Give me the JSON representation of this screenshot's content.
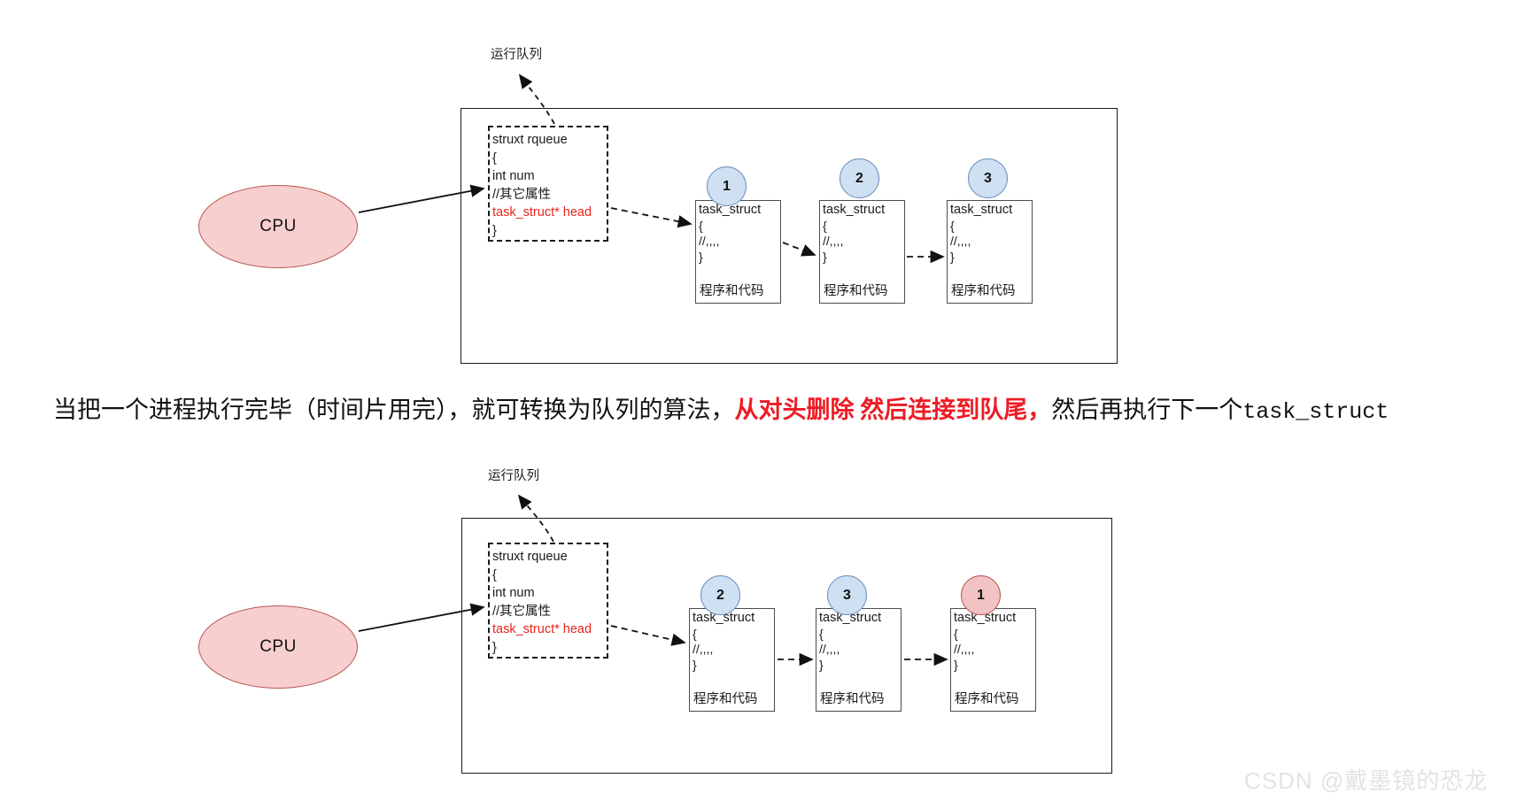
{
  "diagram": {
    "type": "linked-list-run-queue",
    "caption": {
      "part1": "当把一个进程执行完毕（时间片用完），就可转换为队列的算法，",
      "part2_red": "从对头删除 然后连接到队尾，",
      "part3": "然后再执行下一个",
      "part4_mono": "task_struct"
    },
    "top": {
      "queue_label": "运行队列",
      "cpu_label": "CPU",
      "rqueue": {
        "lines": [
          {
            "text": "struxt rqueue",
            "color": "black"
          },
          {
            "text": "{",
            "color": "black"
          },
          {
            "text": "int num",
            "color": "black"
          },
          {
            "text": "//其它属性",
            "color": "black"
          },
          {
            "text": "task_struct* head",
            "color": "red"
          },
          {
            "text": "}",
            "color": "black"
          }
        ]
      },
      "nodes": [
        {
          "badge": "1",
          "badge_color": "blue",
          "title": "task_struct",
          "open": "{",
          "body": "//,,,,",
          "close": "}",
          "footer": "程序和代码"
        },
        {
          "badge": "2",
          "badge_color": "blue",
          "title": "task_struct",
          "open": "{",
          "body": "//,,,,",
          "close": "}",
          "footer": "程序和代码"
        },
        {
          "badge": "3",
          "badge_color": "blue",
          "title": "task_struct",
          "open": "{",
          "body": "//,,,,",
          "close": "}",
          "footer": "程序和代码"
        }
      ]
    },
    "bottom": {
      "queue_label": "运行队列",
      "cpu_label": "CPU",
      "rqueue": {
        "lines": [
          {
            "text": "struxt rqueue",
            "color": "black"
          },
          {
            "text": "{",
            "color": "black"
          },
          {
            "text": "int num",
            "color": "black"
          },
          {
            "text": "//其它属性",
            "color": "black"
          },
          {
            "text": "task_struct* head",
            "color": "red"
          },
          {
            "text": "}",
            "color": "black"
          }
        ]
      },
      "nodes": [
        {
          "badge": "2",
          "badge_color": "blue",
          "title": "task_struct",
          "open": "{",
          "body": "//,,,,",
          "close": "}",
          "footer": "程序和代码"
        },
        {
          "badge": "3",
          "badge_color": "blue",
          "title": "task_struct",
          "open": "{",
          "body": "//,,,,",
          "close": "}",
          "footer": "程序和代码"
        },
        {
          "badge": "1",
          "badge_color": "red",
          "title": "task_struct",
          "open": "{",
          "body": "//,,,,",
          "close": "}",
          "footer": "程序和代码"
        }
      ]
    }
  },
  "watermark": "CSDN @戴墨镜的恐龙",
  "colors": {
    "cpu_fill": "#f7cfcf",
    "cpu_stroke": "#b85450",
    "badge_blue_fill": "#cfe0f3",
    "badge_blue_stroke": "#6c8ebf",
    "badge_red_fill": "#f2c3c3",
    "badge_red_stroke": "#b85450",
    "accent_red_text": "#e8241a",
    "caption_red": "#ee1c25",
    "line": "#1a1a1a",
    "watermark": "#e3e3e3"
  }
}
